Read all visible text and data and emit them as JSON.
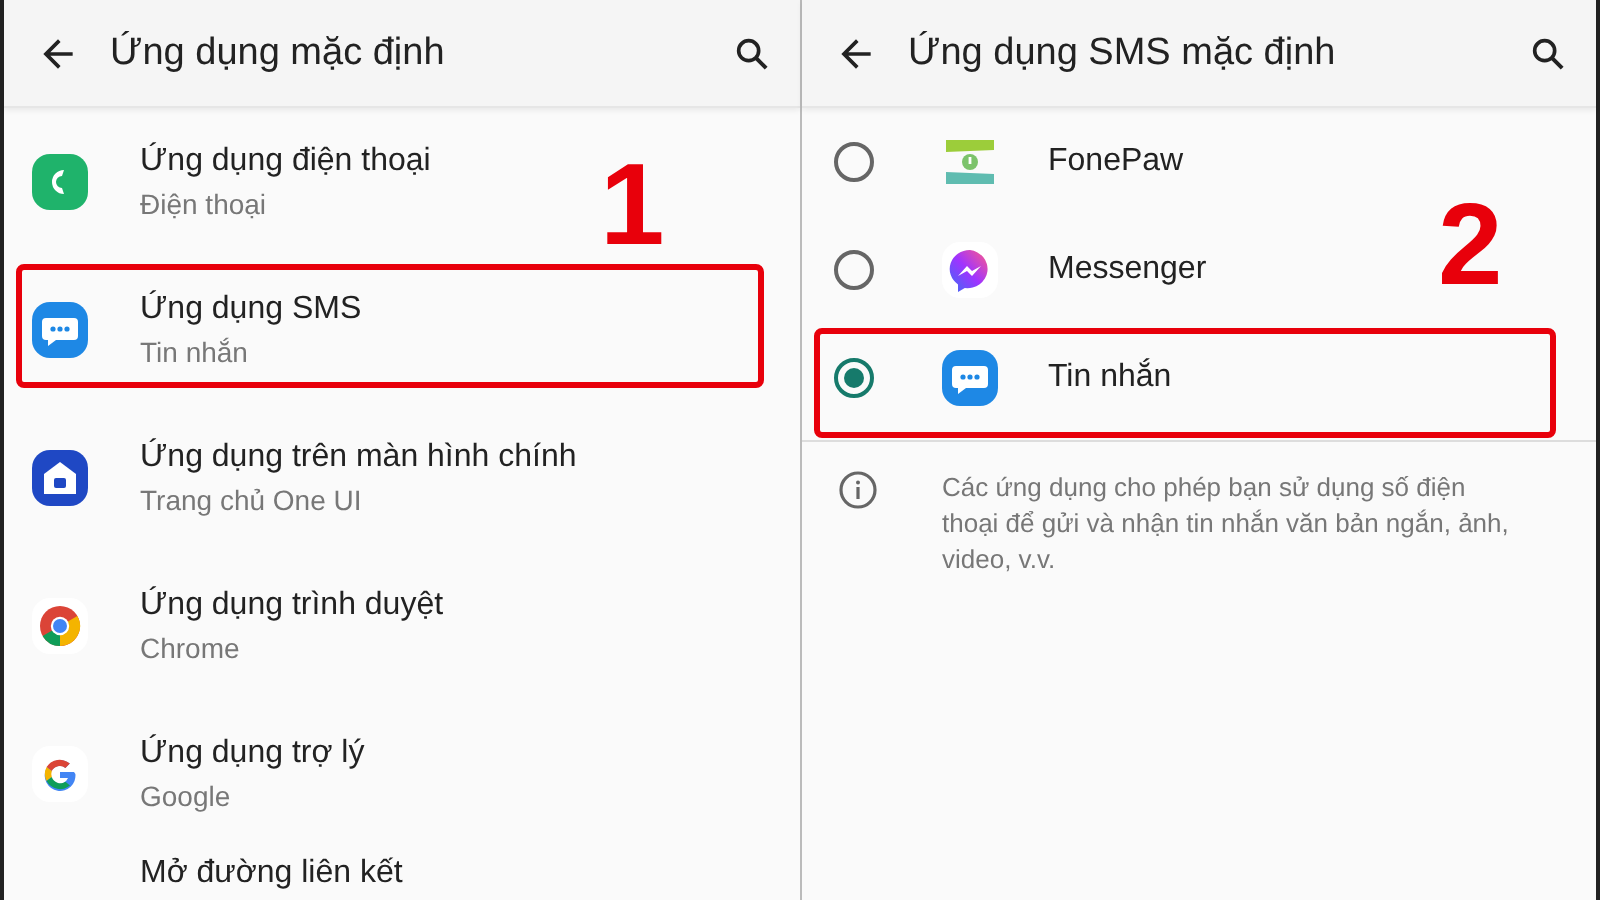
{
  "left": {
    "title": "Ứng dụng mặc định",
    "annotation": "1",
    "items": [
      {
        "title": "Ứng dụng điện thoại",
        "subtitle": "Điện thoại",
        "highlighted": false
      },
      {
        "title": "Ứng dụng SMS",
        "subtitle": "Tin nhắn",
        "highlighted": true
      },
      {
        "title": "Ứng dụng trên màn hình chính",
        "subtitle": "Trang chủ One UI",
        "highlighted": false
      },
      {
        "title": "Ứng dụng trình duyệt",
        "subtitle": "Chrome",
        "highlighted": false
      },
      {
        "title": "Ứng dụng trợ lý",
        "subtitle": "Google",
        "highlighted": false
      },
      {
        "title": "Mở đường liên kết"
      }
    ]
  },
  "right": {
    "title": "Ứng dụng SMS mặc định",
    "annotation": "2",
    "options": [
      {
        "label": "FonePaw",
        "selected": false,
        "highlighted": false
      },
      {
        "label": "Messenger",
        "selected": false,
        "highlighted": false
      },
      {
        "label": "Tin nhắn",
        "selected": true,
        "highlighted": true
      }
    ],
    "info": "Các ứng dụng cho phép bạn sử dụng số điện thoại để gửi và nhận tin nhắn văn bản ngắn, ảnh, video, v.v."
  }
}
